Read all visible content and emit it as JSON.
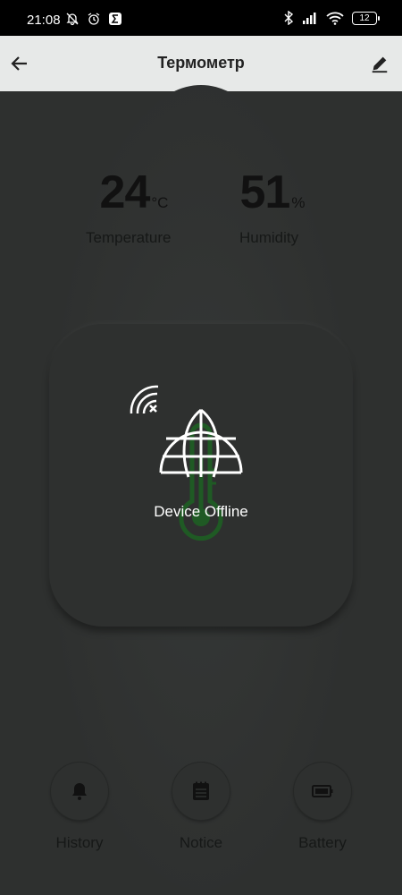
{
  "status_bar": {
    "time": "21:08",
    "battery": "12"
  },
  "app_bar": {
    "title": "Термометр"
  },
  "metrics": {
    "temperature": {
      "value": "24",
      "unit": "°C",
      "label": "Temperature"
    },
    "humidity": {
      "value": "51",
      "unit": "%",
      "label": "Humidity"
    }
  },
  "device": {
    "status_text": "Device Offline"
  },
  "actions": [
    {
      "label": "History",
      "icon": "bell-icon"
    },
    {
      "label": "Notice",
      "icon": "notepad-icon"
    },
    {
      "label": "Battery",
      "icon": "battery-icon"
    }
  ],
  "colors": {
    "background": "#2e302f",
    "app_bar": "#e7e9e8",
    "thermometer": "#1f5a24",
    "offline_text": "#ffffff"
  }
}
